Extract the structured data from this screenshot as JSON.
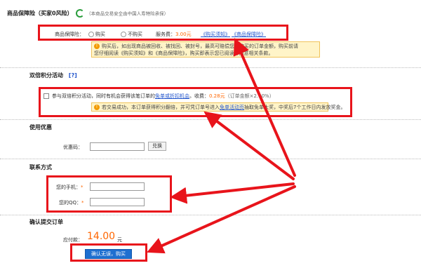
{
  "insurance": {
    "header": "商品保障险（买家0风险）",
    "note": "（本商品交易安全由中国人寿特险承保）",
    "label": "商品保障险：",
    "option_buy": "购买",
    "option_nobuy": "不购买",
    "fee_label": "服务费：",
    "fee_value": "3.00元",
    "link1": "《购买须知》",
    "link2": "《商品保障险》",
    "notice_line1": "购买后，如出现商品被回收、被找回、被封号，最高可赔偿您所购买的订单金额，购买前请",
    "notice_line2": "您仔细阅读《购买须知》和《商品保障险》，购买即表示您已阅读并同意相关条款。"
  },
  "double_points": {
    "header": "双倍积分活动",
    "help": "[?]",
    "text_pre": "参与双倍积分活动，同时有机会获得该笔订单的",
    "text_link": "免单或折扣机会",
    "text_fee": "。收费：",
    "fee_value": "0.28元",
    "fee_detail": "（订单金额×2.00%）",
    "notice_pre": "若交易成功，本订单获得积分翻倍，并可凭订单号进入",
    "notice_link": "免单活动页",
    "notice_post": "抽取免单大奖，中奖后7个工作日内发放奖金。"
  },
  "coupon": {
    "header": "使用优惠",
    "label": "优惠码：",
    "value": "",
    "button": "兑换"
  },
  "contact": {
    "header": "联系方式",
    "phone_label": "您的手机：",
    "phone_value": "",
    "qq_label": "您的QQ：",
    "qq_value": "",
    "required": "*"
  },
  "confirm": {
    "header": "确认提交订单",
    "pay_label": "应付款：",
    "pay_amount": "14.00",
    "pay_unit": "元",
    "submit": "确认无误，购买"
  },
  "colors": {
    "accent_red": "#e8141b",
    "price_orange": "#ff6600",
    "link_blue": "#2255cc",
    "button_blue": "#1e6fd0"
  }
}
